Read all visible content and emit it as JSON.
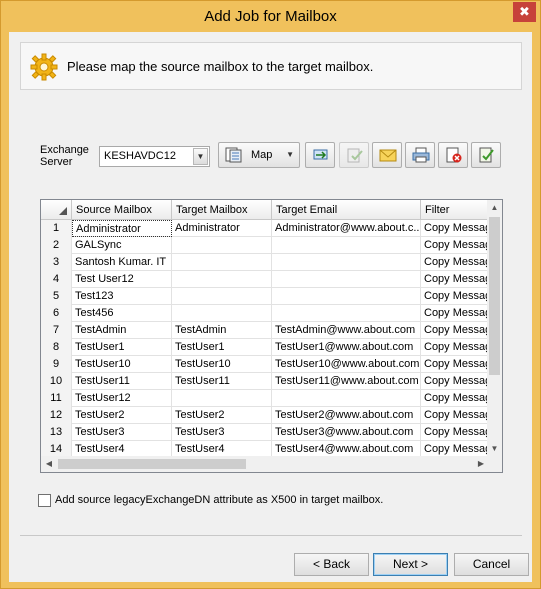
{
  "window": {
    "title": "Add Job for Mailbox",
    "close_glyph": "✖"
  },
  "banner": {
    "icon": "gear-icon",
    "text": "Please map the source mailbox to the target mailbox."
  },
  "toolbar": {
    "server_label_line1": "Exchange",
    "server_label_line2": "Server",
    "server_value": "KESHAVDC12",
    "map_label": "Map",
    "icons": [
      "map-icon",
      "connect-icon",
      "disabled-check-icon",
      "email-icon",
      "print-icon",
      "delete-icon",
      "verify-icon"
    ]
  },
  "grid": {
    "columns": [
      "Source Mailbox",
      "Target Mailbox",
      "Target Email",
      "Filter"
    ],
    "rows": [
      {
        "n": "1",
        "src": "Administrator",
        "tgt": "Administrator",
        "email": "Administrator@www.about.c...",
        "filter": "Copy Messag"
      },
      {
        "n": "2",
        "src": "GALSync",
        "tgt": "",
        "email": "",
        "filter": "Copy Messag"
      },
      {
        "n": "3",
        "src": "Santosh Kumar. IT",
        "tgt": "",
        "email": "",
        "filter": "Copy Messag"
      },
      {
        "n": "4",
        "src": "Test User12",
        "tgt": "",
        "email": "",
        "filter": "Copy Messag"
      },
      {
        "n": "5",
        "src": "Test123",
        "tgt": "",
        "email": "",
        "filter": "Copy Messag"
      },
      {
        "n": "6",
        "src": "Test456",
        "tgt": "",
        "email": "",
        "filter": "Copy Messag"
      },
      {
        "n": "7",
        "src": "TestAdmin",
        "tgt": "TestAdmin",
        "email": "TestAdmin@www.about.com",
        "filter": "Copy Messag"
      },
      {
        "n": "8",
        "src": "TestUser1",
        "tgt": "TestUser1",
        "email": "TestUser1@www.about.com",
        "filter": "Copy Messag"
      },
      {
        "n": "9",
        "src": "TestUser10",
        "tgt": "TestUser10",
        "email": "TestUser10@www.about.com",
        "filter": "Copy Messag"
      },
      {
        "n": "10",
        "src": "TestUser11",
        "tgt": "TestUser11",
        "email": "TestUser11@www.about.com",
        "filter": "Copy Messag"
      },
      {
        "n": "11",
        "src": "TestUser12",
        "tgt": "",
        "email": "",
        "filter": "Copy Messag"
      },
      {
        "n": "12",
        "src": "TestUser2",
        "tgt": "TestUser2",
        "email": "TestUser2@www.about.com",
        "filter": "Copy Messag"
      },
      {
        "n": "13",
        "src": "TestUser3",
        "tgt": "TestUser3",
        "email": "TestUser3@www.about.com",
        "filter": "Copy Messag"
      },
      {
        "n": "14",
        "src": "TestUser4",
        "tgt": "TestUser4",
        "email": "TestUser4@www.about.com",
        "filter": "Copy Messag"
      }
    ]
  },
  "options": {
    "x500_label": "Add source legacyExchangeDN attribute as X500 in target mailbox.",
    "x500_checked": false
  },
  "buttons": {
    "back": "< Back",
    "next": "Next >",
    "cancel": "Cancel"
  },
  "colors": {
    "title_bar": "#f0c15c",
    "close": "#c7423a",
    "client": "#f0f0f0"
  }
}
